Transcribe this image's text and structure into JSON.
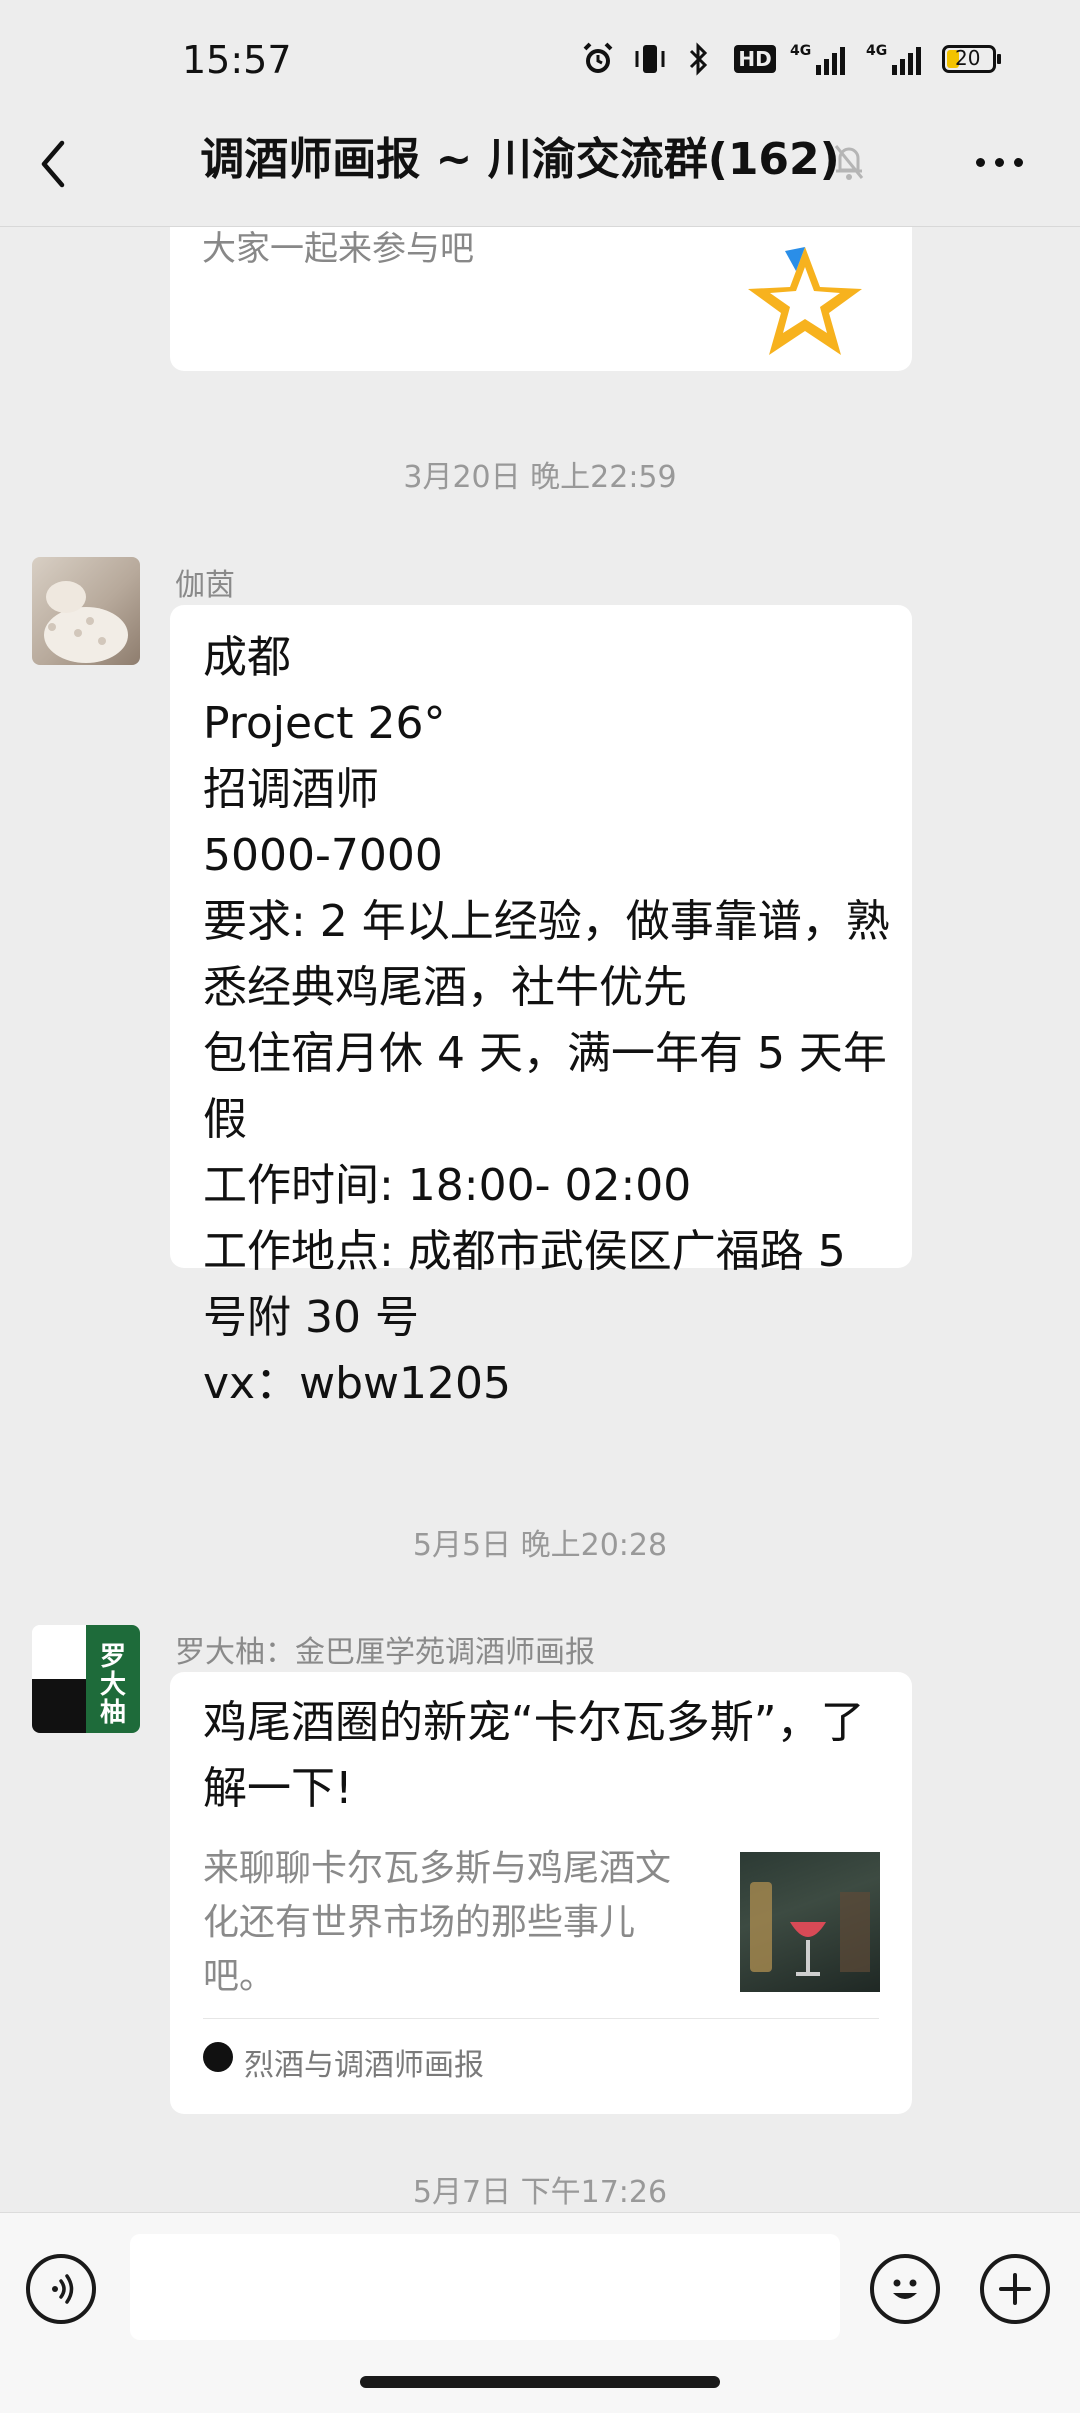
{
  "status_bar": {
    "time": "15:57",
    "battery": "20",
    "icons": [
      "alarm-icon",
      "vibrate-icon",
      "bluetooth-icon",
      "hd-icon",
      "4g-signal-icon",
      "4g-signal-icon",
      "battery-icon"
    ]
  },
  "header": {
    "title": "调酒师画报 ~ 川渝交流群(162)",
    "back_icon": "chevron-left-icon",
    "mute_icon": "bell-muted-icon",
    "more_icon": "more-icon"
  },
  "messages": [
    {
      "type": "card_fragment",
      "text": "大家一起来参与吧",
      "icon": "star-icon"
    },
    {
      "type": "timestamp",
      "text": "3月20日 晚上22:59"
    },
    {
      "type": "text",
      "sender": "伽茵",
      "lines": [
        "成都",
        "Project 26°",
        "招调酒师",
        "5000-7000",
        "要求: 2 年以上经验，做事靠谱，熟",
        "悉经典鸡尾酒，社牛优先",
        "包住宿月休 4 天，满一年有 5 天年",
        "假",
        "工作时间: 18:00- 02:00",
        "工作地点: 成都市武侯区广福路 5",
        "号附 30 号",
        "vx：wbw1205"
      ]
    },
    {
      "type": "timestamp",
      "text": "5月5日 晚上20:28"
    },
    {
      "type": "article",
      "sender": "罗大柚：金巴厘学苑调酒师画报",
      "avatar_text": "罗大柚",
      "title_lines": [
        "鸡尾酒圈的新宠“卡尔瓦多斯”，了",
        "解一下!"
      ],
      "desc_lines": [
        "来聊聊卡尔瓦多斯与鸡尾酒文",
        "化还有世界市场的那些事儿",
        "吧。"
      ],
      "source": "烈酒与调酒师画报"
    },
    {
      "type": "timestamp",
      "text": "5月7日 下午17:26"
    }
  ],
  "input_bar": {
    "voice_icon": "voice-icon",
    "emoji_icon": "emoji-icon",
    "add_icon": "plus-icon"
  },
  "colors": {
    "background": "#ededed",
    "bubble": "#ffffff",
    "timestamp": "#999999",
    "avatar_green": "#1e6b3a"
  }
}
